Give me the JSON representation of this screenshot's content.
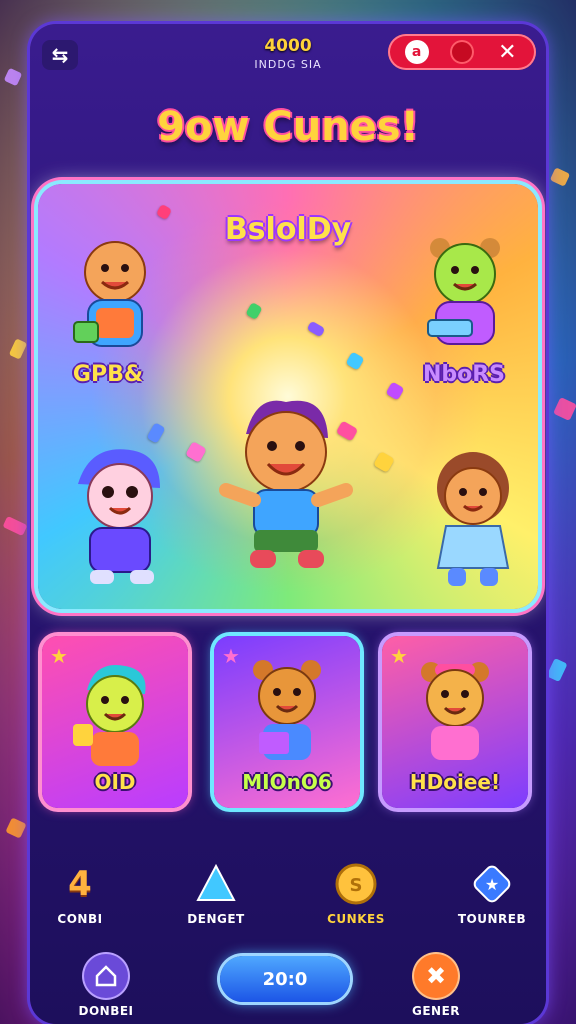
{
  "header": {
    "score_value": "4000",
    "score_label": "INDDG SIA",
    "pill_a": "a"
  },
  "title": "9ow Cunes!",
  "stage": {
    "name": "BslolDy",
    "labels": {
      "top_left": "GPB&",
      "top_right": "NboRS"
    }
  },
  "cards": [
    {
      "label": "OID",
      "label_color": "#ffe14a"
    },
    {
      "label": "MIOnO6",
      "label_color": "#c6ff4a"
    },
    {
      "label": "HDoiee!",
      "label_color": "#ffe14a"
    }
  ],
  "nav": {
    "items": [
      {
        "label": "CONBI",
        "icon": "number-4-icon",
        "glyph": "4"
      },
      {
        "label": "DENGET",
        "icon": "triangle-gem-icon"
      },
      {
        "label": "CUNKES",
        "icon": "coin-icon"
      },
      {
        "label": "TOUNREB",
        "icon": "star-gem-icon"
      }
    ]
  },
  "bottom": {
    "left_label": "DONBEI",
    "play_label": "20:0",
    "right_label": "GENER"
  },
  "colors": {
    "accent": "#ffd33d",
    "frame": "#2a1575",
    "pill": "#e3143a",
    "play": "#1c55e6"
  }
}
